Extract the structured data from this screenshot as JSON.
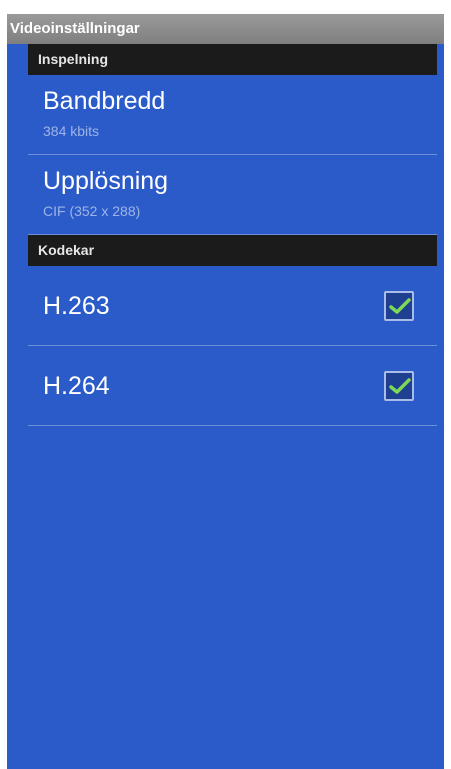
{
  "titlebar": {
    "title": "Videoinställningar"
  },
  "sections": [
    {
      "header": "Inspelning",
      "items": [
        {
          "title": "Bandbredd",
          "summary": "384 kbits"
        },
        {
          "title": "Upplösning",
          "summary": "CIF (352 x 288)"
        }
      ]
    },
    {
      "header": "Kodekar",
      "items": [
        {
          "title": "H.263",
          "checked": true,
          "icon": "check-icon"
        },
        {
          "title": "H.264",
          "checked": true,
          "icon": "check-icon"
        }
      ]
    }
  ],
  "colors": {
    "background": "#2a5bc8",
    "section_header": "#1b1b1b",
    "check": "#7ed957"
  }
}
